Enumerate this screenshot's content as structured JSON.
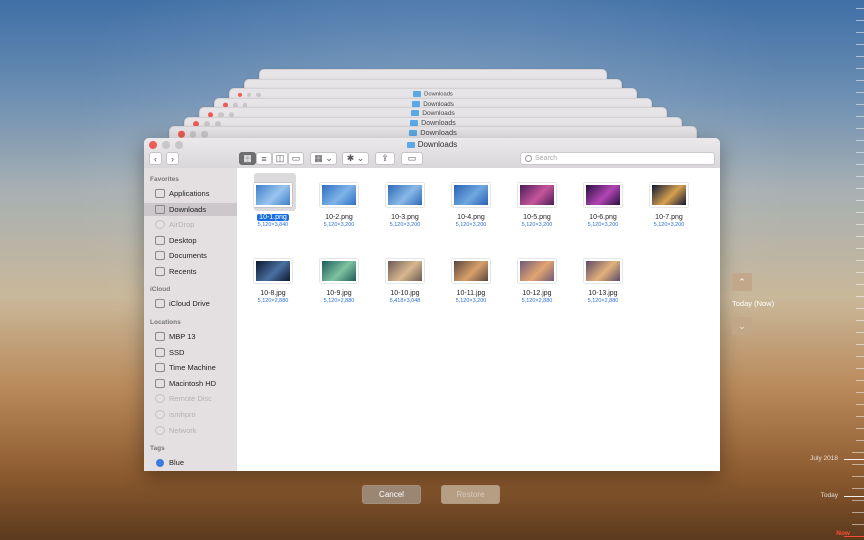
{
  "background_windows": [
    {
      "title": ""
    },
    {
      "title": ""
    },
    {
      "title": "Downloads"
    },
    {
      "title": "Downloads"
    },
    {
      "title": "Downloads"
    },
    {
      "title": "Downloads"
    },
    {
      "title": "Downloads"
    }
  ],
  "window": {
    "title": "Downloads",
    "search_placeholder": "Search",
    "toolbar": {
      "back": "‹",
      "forward": "›",
      "view_icons": "icon-view",
      "view_list": "list-view",
      "view_columns": "column-view",
      "view_gallery": "gallery-view",
      "group": "group-menu",
      "action": "action-menu",
      "share": "share-icon",
      "tag": "tag-icon"
    },
    "sidebar": {
      "favorites_heading": "Favorites",
      "favorites": [
        {
          "label": "Applications",
          "icon": "applications-icon"
        },
        {
          "label": "Downloads",
          "icon": "downloads-icon"
        },
        {
          "label": "AirDrop",
          "icon": "airdrop-icon"
        },
        {
          "label": "Desktop",
          "icon": "desktop-icon"
        },
        {
          "label": "Documents",
          "icon": "documents-icon"
        },
        {
          "label": "Recents",
          "icon": "recents-icon"
        }
      ],
      "icloud_heading": "iCloud",
      "icloud": [
        {
          "label": "iCloud Drive",
          "icon": "cloud-icon"
        }
      ],
      "locations_heading": "Locations",
      "locations": [
        {
          "label": "MBP 13",
          "icon": "laptop-icon"
        },
        {
          "label": "SSD",
          "icon": "drive-icon"
        },
        {
          "label": "Time Machine",
          "icon": "drive-icon"
        },
        {
          "label": "Macintosh HD",
          "icon": "drive-icon"
        },
        {
          "label": "Remote Disc",
          "icon": "disc-icon"
        },
        {
          "label": "ismhpro",
          "icon": "computer-icon"
        },
        {
          "label": "Network",
          "icon": "network-icon"
        }
      ],
      "tags_heading": "Tags",
      "tags": [
        {
          "label": "Blue",
          "color": "#3a7ce0"
        }
      ]
    },
    "files": [
      {
        "name": "10-1.png",
        "size": "5,120×3,840",
        "selected": true,
        "colors": [
          "#3d7fc9",
          "#9ac4ee"
        ]
      },
      {
        "name": "10-2.png",
        "size": "5,120×3,200",
        "colors": [
          "#2e6fc0",
          "#7fb4e8"
        ]
      },
      {
        "name": "10-3.png",
        "size": "5,120×3,200",
        "colors": [
          "#2d68b8",
          "#8ab9e6"
        ]
      },
      {
        "name": "10-4.png",
        "size": "5,120×3,200",
        "colors": [
          "#2a63b3",
          "#6fa7e0"
        ]
      },
      {
        "name": "10-5.png",
        "size": "5,120×3,200",
        "colors": [
          "#4b1d5a",
          "#c4569a"
        ]
      },
      {
        "name": "10-6.png",
        "size": "5,120×3,200",
        "colors": [
          "#2a1040",
          "#b246b4"
        ]
      },
      {
        "name": "10-7.png",
        "size": "5,120×3,200",
        "colors": [
          "#0f1838",
          "#d6a04e"
        ]
      },
      {
        "name": "10-8.jpg",
        "size": "5,120×2,880",
        "colors": [
          "#0d1830",
          "#4a6fa0"
        ]
      },
      {
        "name": "10-9.jpg",
        "size": "5,120×2,880",
        "colors": [
          "#1d5c5a",
          "#7fc2a0"
        ]
      },
      {
        "name": "10-10.jpg",
        "size": "5,418×3,048",
        "colors": [
          "#6b5a54",
          "#d8b890"
        ]
      },
      {
        "name": "10-11.jpg",
        "size": "5,120×3,200",
        "colors": [
          "#5a4640",
          "#d7a06a"
        ]
      },
      {
        "name": "10-12.jpg",
        "size": "5,120×2,880",
        "colors": [
          "#6e5a78",
          "#e3a572"
        ]
      },
      {
        "name": "10-13.jpg",
        "size": "5,120×2,880",
        "colors": [
          "#5c4a6a",
          "#e2b27a"
        ]
      }
    ]
  },
  "buttons": {
    "cancel": "Cancel",
    "restore": "Restore"
  },
  "time_machine": {
    "up_arrow": "⌃",
    "down_arrow": "⌄",
    "current_label": "Today (Now)",
    "timeline": [
      {
        "label": "July 2018"
      },
      {
        "label": "Today"
      },
      {
        "label": "Now",
        "color": "#ff4a3a"
      }
    ]
  }
}
